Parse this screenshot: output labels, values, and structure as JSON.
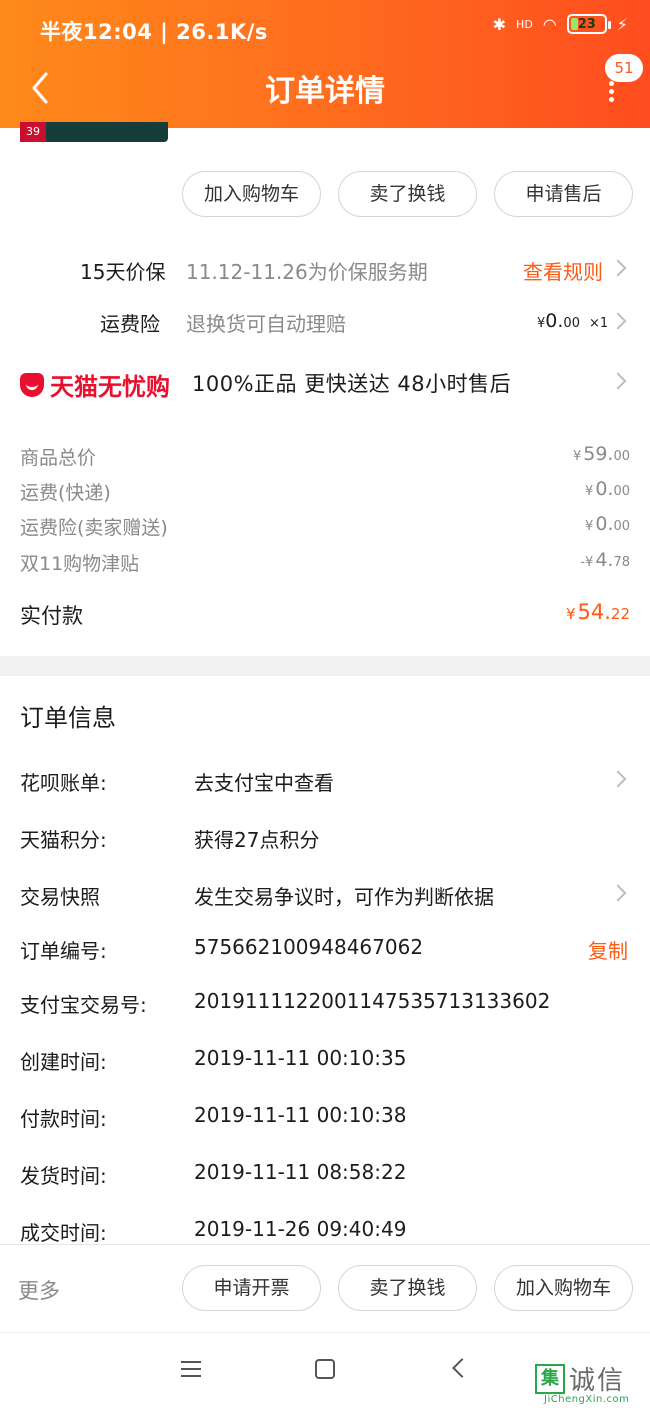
{
  "status_bar": {
    "left_text": "半夜12:04 | 26.1K/s",
    "battery": "23",
    "battery_level": 0.23,
    "network_label": "HD"
  },
  "nav": {
    "title": "订单详情",
    "badge": "51"
  },
  "actions_top": [
    "加入购物车",
    "卖了换钱",
    "申请售后"
  ],
  "price_protect": {
    "label": "15天价保",
    "text": "11.12-11.26为价保服务期",
    "link": "查看规则"
  },
  "shipping_insurance": {
    "label": "运费险",
    "text": "退换货可自动理赔",
    "yen": "¥",
    "amount": "0.",
    "amount_small": "00",
    "qty": "×1"
  },
  "tmall": {
    "brand": "天猫无忧购",
    "guarantee": "100%正品  更快送达  48小时售后"
  },
  "price_rows": [
    {
      "label": "商品总价",
      "prefix": "¥",
      "big": "59.",
      "small": "00"
    },
    {
      "label": "运费(快递)",
      "prefix": "¥",
      "big": "0.",
      "small": "00"
    },
    {
      "label": "运费险(卖家赠送)",
      "prefix": "¥",
      "big": "0.",
      "small": "00"
    },
    {
      "label": "双11购物津贴",
      "prefix": "-¥",
      "big": "4.",
      "small": "78"
    }
  ],
  "total": {
    "label": "实付款",
    "prefix": "¥",
    "big": "54.",
    "small": "22"
  },
  "order_info": {
    "title": "订单信息",
    "rows": [
      {
        "label": "花呗账单:",
        "value": "去支付宝中查看"
      },
      {
        "label": "天猫积分:",
        "value": "获得27点积分"
      },
      {
        "label": "交易快照",
        "value": "发生交易争议时，可作为判断依据"
      },
      {
        "label": "订单编号:",
        "value": "575662100948467062"
      },
      {
        "label": "支付宝交易号:",
        "value": "2019111122001147535713133602"
      },
      {
        "label": "创建时间:",
        "value": "2019-11-11 00:10:35"
      },
      {
        "label": "付款时间:",
        "value": "2019-11-11 00:10:38"
      },
      {
        "label": "发货时间:",
        "value": "2019-11-11 08:58:22"
      },
      {
        "label": "成交时间:",
        "value": "2019-11-26 09:40:49"
      }
    ],
    "copy": "复制"
  },
  "bottom_bar": {
    "more": "更多",
    "actions": [
      "申请开票",
      "卖了换钱",
      "加入购物车"
    ]
  },
  "watermark": {
    "box": "集",
    "text": "诚信",
    "sub": "JiChengXin.com"
  }
}
